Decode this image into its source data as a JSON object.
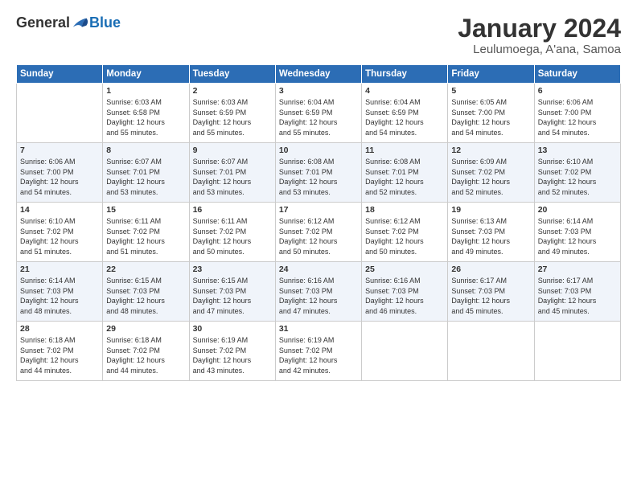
{
  "logo": {
    "general": "General",
    "blue": "Blue"
  },
  "title": "January 2024",
  "subtitle": "Leulumoega, A'ana, Samoa",
  "days_of_week": [
    "Sunday",
    "Monday",
    "Tuesday",
    "Wednesday",
    "Thursday",
    "Friday",
    "Saturday"
  ],
  "weeks": [
    [
      {
        "day": "",
        "content": ""
      },
      {
        "day": "1",
        "content": "Sunrise: 6:03 AM\nSunset: 6:58 PM\nDaylight: 12 hours\nand 55 minutes."
      },
      {
        "day": "2",
        "content": "Sunrise: 6:03 AM\nSunset: 6:59 PM\nDaylight: 12 hours\nand 55 minutes."
      },
      {
        "day": "3",
        "content": "Sunrise: 6:04 AM\nSunset: 6:59 PM\nDaylight: 12 hours\nand 55 minutes."
      },
      {
        "day": "4",
        "content": "Sunrise: 6:04 AM\nSunset: 6:59 PM\nDaylight: 12 hours\nand 54 minutes."
      },
      {
        "day": "5",
        "content": "Sunrise: 6:05 AM\nSunset: 7:00 PM\nDaylight: 12 hours\nand 54 minutes."
      },
      {
        "day": "6",
        "content": "Sunrise: 6:06 AM\nSunset: 7:00 PM\nDaylight: 12 hours\nand 54 minutes."
      }
    ],
    [
      {
        "day": "7",
        "content": "Sunrise: 6:06 AM\nSunset: 7:00 PM\nDaylight: 12 hours\nand 54 minutes."
      },
      {
        "day": "8",
        "content": "Sunrise: 6:07 AM\nSunset: 7:01 PM\nDaylight: 12 hours\nand 53 minutes."
      },
      {
        "day": "9",
        "content": "Sunrise: 6:07 AM\nSunset: 7:01 PM\nDaylight: 12 hours\nand 53 minutes."
      },
      {
        "day": "10",
        "content": "Sunrise: 6:08 AM\nSunset: 7:01 PM\nDaylight: 12 hours\nand 53 minutes."
      },
      {
        "day": "11",
        "content": "Sunrise: 6:08 AM\nSunset: 7:01 PM\nDaylight: 12 hours\nand 52 minutes."
      },
      {
        "day": "12",
        "content": "Sunrise: 6:09 AM\nSunset: 7:02 PM\nDaylight: 12 hours\nand 52 minutes."
      },
      {
        "day": "13",
        "content": "Sunrise: 6:10 AM\nSunset: 7:02 PM\nDaylight: 12 hours\nand 52 minutes."
      }
    ],
    [
      {
        "day": "14",
        "content": "Sunrise: 6:10 AM\nSunset: 7:02 PM\nDaylight: 12 hours\nand 51 minutes."
      },
      {
        "day": "15",
        "content": "Sunrise: 6:11 AM\nSunset: 7:02 PM\nDaylight: 12 hours\nand 51 minutes."
      },
      {
        "day": "16",
        "content": "Sunrise: 6:11 AM\nSunset: 7:02 PM\nDaylight: 12 hours\nand 50 minutes."
      },
      {
        "day": "17",
        "content": "Sunrise: 6:12 AM\nSunset: 7:02 PM\nDaylight: 12 hours\nand 50 minutes."
      },
      {
        "day": "18",
        "content": "Sunrise: 6:12 AM\nSunset: 7:02 PM\nDaylight: 12 hours\nand 50 minutes."
      },
      {
        "day": "19",
        "content": "Sunrise: 6:13 AM\nSunset: 7:03 PM\nDaylight: 12 hours\nand 49 minutes."
      },
      {
        "day": "20",
        "content": "Sunrise: 6:14 AM\nSunset: 7:03 PM\nDaylight: 12 hours\nand 49 minutes."
      }
    ],
    [
      {
        "day": "21",
        "content": "Sunrise: 6:14 AM\nSunset: 7:03 PM\nDaylight: 12 hours\nand 48 minutes."
      },
      {
        "day": "22",
        "content": "Sunrise: 6:15 AM\nSunset: 7:03 PM\nDaylight: 12 hours\nand 48 minutes."
      },
      {
        "day": "23",
        "content": "Sunrise: 6:15 AM\nSunset: 7:03 PM\nDaylight: 12 hours\nand 47 minutes."
      },
      {
        "day": "24",
        "content": "Sunrise: 6:16 AM\nSunset: 7:03 PM\nDaylight: 12 hours\nand 47 minutes."
      },
      {
        "day": "25",
        "content": "Sunrise: 6:16 AM\nSunset: 7:03 PM\nDaylight: 12 hours\nand 46 minutes."
      },
      {
        "day": "26",
        "content": "Sunrise: 6:17 AM\nSunset: 7:03 PM\nDaylight: 12 hours\nand 45 minutes."
      },
      {
        "day": "27",
        "content": "Sunrise: 6:17 AM\nSunset: 7:03 PM\nDaylight: 12 hours\nand 45 minutes."
      }
    ],
    [
      {
        "day": "28",
        "content": "Sunrise: 6:18 AM\nSunset: 7:02 PM\nDaylight: 12 hours\nand 44 minutes."
      },
      {
        "day": "29",
        "content": "Sunrise: 6:18 AM\nSunset: 7:02 PM\nDaylight: 12 hours\nand 44 minutes."
      },
      {
        "day": "30",
        "content": "Sunrise: 6:19 AM\nSunset: 7:02 PM\nDaylight: 12 hours\nand 43 minutes."
      },
      {
        "day": "31",
        "content": "Sunrise: 6:19 AM\nSunset: 7:02 PM\nDaylight: 12 hours\nand 42 minutes."
      },
      {
        "day": "",
        "content": ""
      },
      {
        "day": "",
        "content": ""
      },
      {
        "day": "",
        "content": ""
      }
    ]
  ]
}
